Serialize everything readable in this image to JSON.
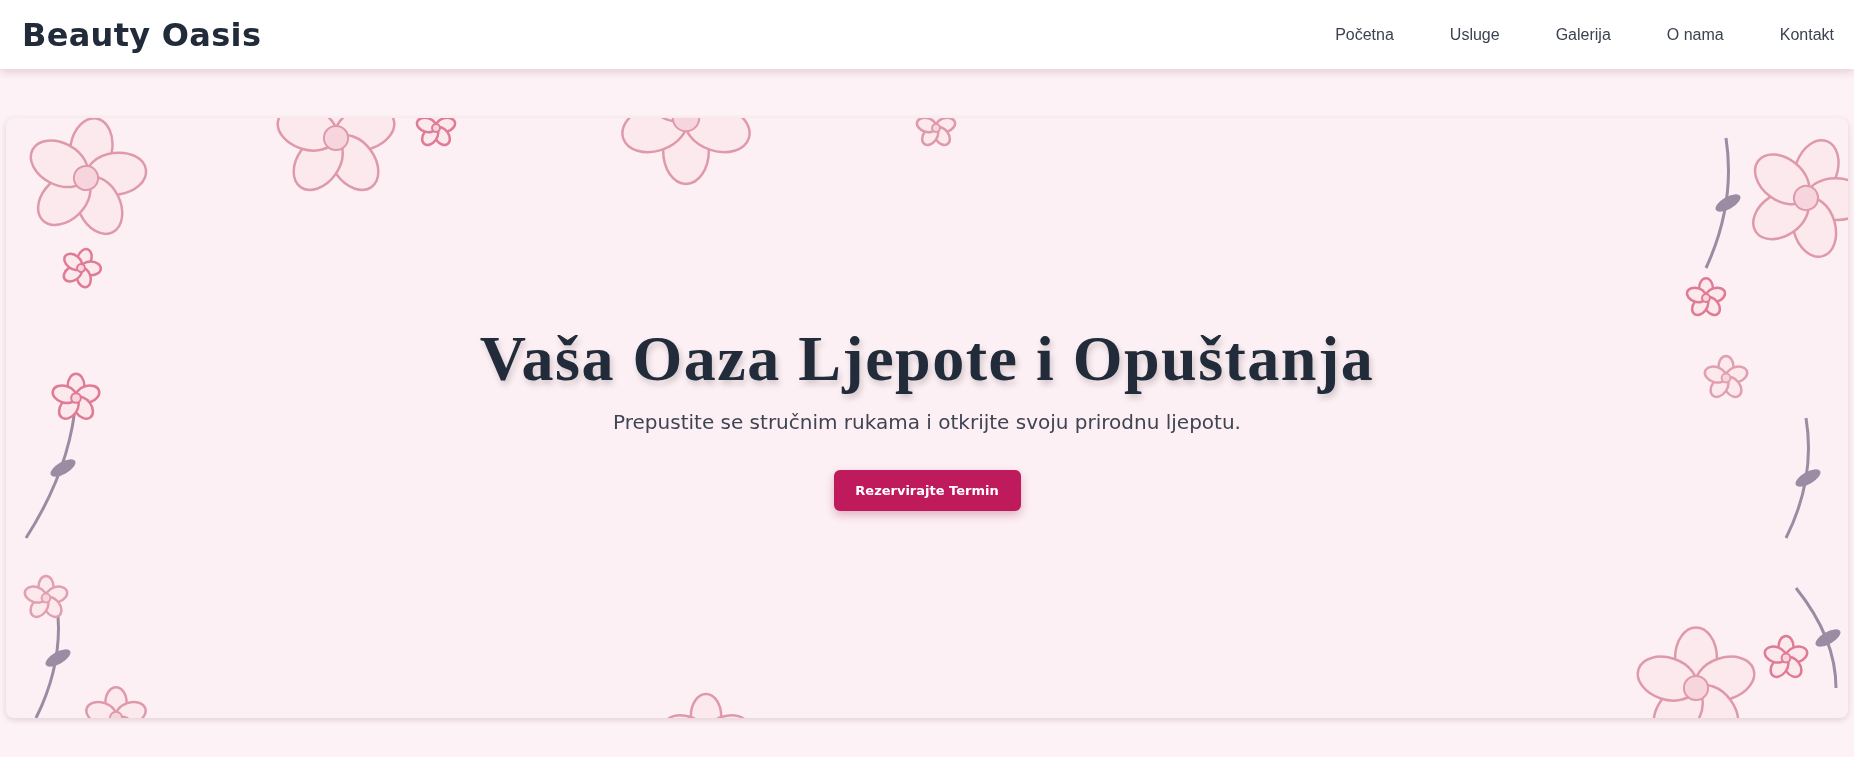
{
  "header": {
    "logo": "Beauty Oasis",
    "nav": [
      "Početna",
      "Usluge",
      "Galerija",
      "O nama",
      "Kontakt"
    ]
  },
  "hero": {
    "title": "Vaša Oaza Ljepote i Opuštanja",
    "subtitle": "Prepustite se stručnim rukama i otkrijte svoju prirodnu ljepotu.",
    "button": "Rezervirajte Termin"
  }
}
